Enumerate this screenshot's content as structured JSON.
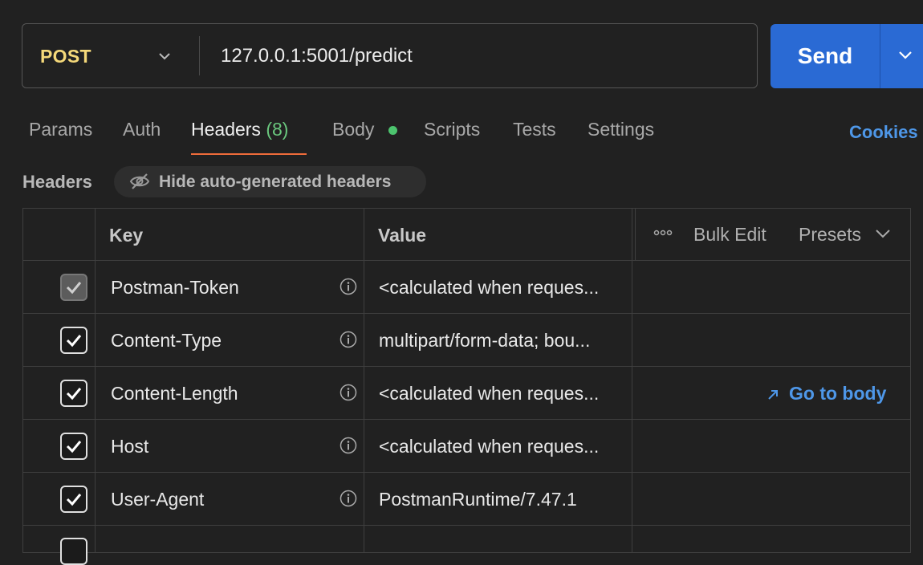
{
  "request": {
    "method": "POST",
    "url": "127.0.0.1:5001/predict",
    "send_label": "Send"
  },
  "tabs": [
    {
      "label": "Params"
    },
    {
      "label": "Auth"
    },
    {
      "label": "Headers",
      "count": "(8)",
      "active": true
    },
    {
      "label": "Body",
      "has_dot": true
    },
    {
      "label": "Scripts"
    },
    {
      "label": "Tests"
    },
    {
      "label": "Settings"
    }
  ],
  "cookies_label": "Cookies",
  "headers_section": {
    "label": "Headers",
    "hide_auto_label": "Hide auto-generated headers"
  },
  "table": {
    "columns": {
      "key": "Key",
      "value": "Value"
    },
    "bulk_edit_label": "Bulk Edit",
    "presets_label": "Presets",
    "go_to_body_label": "Go to body",
    "rows": [
      {
        "key": "Postman-Token",
        "value": "<calculated when reques...",
        "checked": true,
        "disabled": true
      },
      {
        "key": "Content-Type",
        "value": "multipart/form-data; bou...",
        "checked": true
      },
      {
        "key": "Content-Length",
        "value": "<calculated when reques...",
        "checked": true
      },
      {
        "key": "Host",
        "value": "<calculated when reques...",
        "checked": true
      },
      {
        "key": "User-Agent",
        "value": "PostmanRuntime/7.47.1",
        "checked": true
      }
    ]
  },
  "colors": {
    "accent": "#2a6ad4",
    "method": "#f5d97a",
    "active_tab_underline": "#ef6c3a",
    "headers_count": "#6ac77e",
    "link": "#4e97e8",
    "background": "#212121"
  }
}
